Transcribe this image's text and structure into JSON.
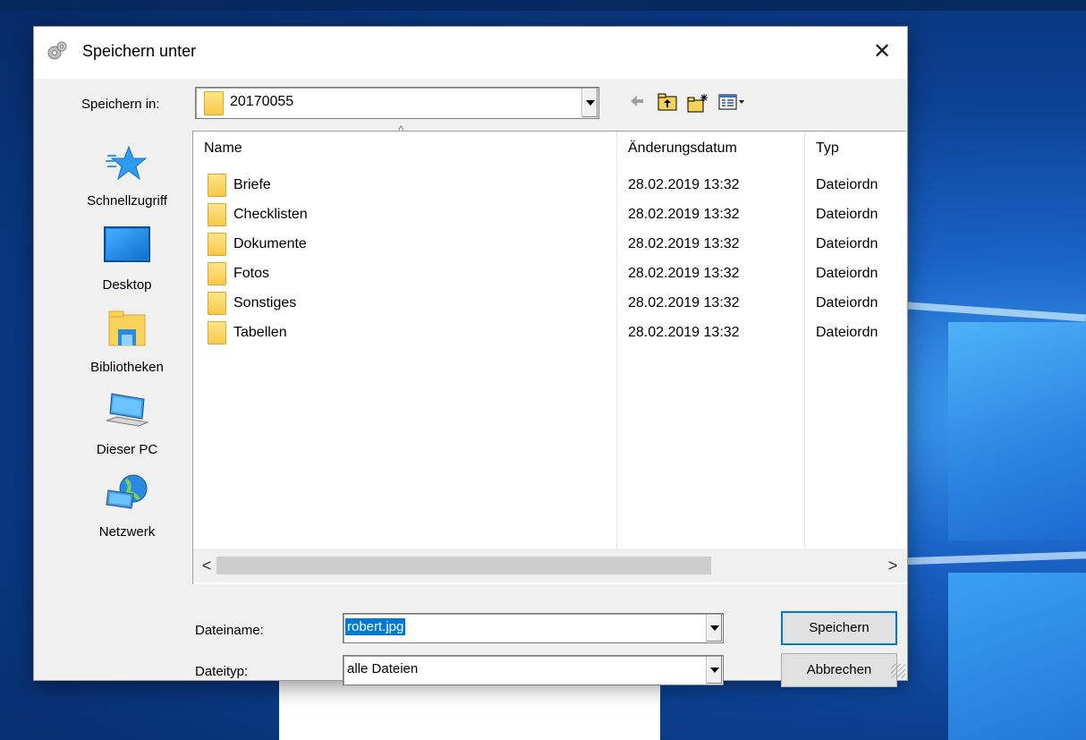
{
  "dialog": {
    "title": "Speichern unter",
    "close_glyph": "✕",
    "title_icon": "gear-icon"
  },
  "location": {
    "label": "Speichern in:",
    "value": "20170055",
    "icon": "folder-icon"
  },
  "toolbar": {
    "back_icon": "back-arrow-icon",
    "up_icon": "folder-up-icon",
    "new_folder_icon": "new-folder-icon",
    "view_icon": "view-menu-icon"
  },
  "places": [
    {
      "label": "Schnellzugriff",
      "icon": "star-icon"
    },
    {
      "label": "Desktop",
      "icon": "desktop-icon"
    },
    {
      "label": "Bibliotheken",
      "icon": "libraries-icon"
    },
    {
      "label": "Dieser PC",
      "icon": "computer-icon"
    },
    {
      "label": "Netzwerk",
      "icon": "network-icon"
    }
  ],
  "file_list": {
    "columns": [
      "Name",
      "Änderungsdatum",
      "Typ"
    ],
    "sort_indicator": "^",
    "rows": [
      {
        "name": "Briefe",
        "date": "28.02.2019 13:32",
        "type": "Dateiordn"
      },
      {
        "name": "Checklisten",
        "date": "28.02.2019 13:32",
        "type": "Dateiordn"
      },
      {
        "name": "Dokumente",
        "date": "28.02.2019 13:32",
        "type": "Dateiordn"
      },
      {
        "name": "Fotos",
        "date": "28.02.2019 13:32",
        "type": "Dateiordn"
      },
      {
        "name": "Sonstiges",
        "date": "28.02.2019 13:32",
        "type": "Dateiordn"
      },
      {
        "name": "Tabellen",
        "date": "28.02.2019 13:32",
        "type": "Dateiordn"
      }
    ],
    "scroll_left": "<",
    "scroll_right": ">"
  },
  "filename": {
    "label": "Dateiname:",
    "value": "robert.jpg"
  },
  "filetype": {
    "label": "Dateityp:",
    "value": "alle Dateien"
  },
  "buttons": {
    "save": "Speichern",
    "cancel": "Abbrechen"
  },
  "colors": {
    "selection": "#0078d7",
    "folder": "#f7c948",
    "dialog_bg": "#f0f0f0"
  }
}
